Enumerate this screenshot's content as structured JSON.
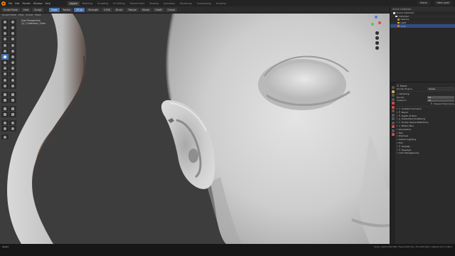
{
  "app": {
    "menu": [
      "File",
      "Edit",
      "Render",
      "Window",
      "Help"
    ],
    "workspaces": [
      "Layout",
      "Modeling",
      "Sculpting",
      "UV Editing",
      "Texture Paint",
      "Shading",
      "Animation",
      "Rendering",
      "Compositing",
      "Scripting"
    ],
    "active_workspace": "Layout",
    "scene": "Scene",
    "view_layer": "View Layer"
  },
  "header": {
    "mode": "Sculpt Mode",
    "items": [
      "View",
      "Sculpt",
      "Mask",
      "Face Sets"
    ],
    "brush_chips": [
      "Draw",
      "Radius",
      "25 px",
      "Strength",
      "0.500"
    ],
    "right_chips": [
      "Brush",
      "Texture",
      "Stroke",
      "Falloff",
      "Cursor"
    ]
  },
  "viewport": {
    "overlay_text": [
      "User Perspective",
      "(1) | Collection | Scan"
    ],
    "subheader": [
      "Sculpt Mode",
      "View",
      "Sculpt",
      "Mask"
    ]
  },
  "outliner": {
    "title": "Scene Collection",
    "rows": [
      {
        "label": "Scene Collection",
        "icon": "collection-icon",
        "state": "normal"
      },
      {
        "label": "Collection",
        "icon": "collection-icon",
        "state": "alt"
      },
      {
        "label": "Camera",
        "icon": "camera-icon",
        "state": "normal"
      },
      {
        "label": "Light",
        "icon": "light-icon",
        "state": "alt"
      },
      {
        "label": "Scan",
        "icon": "object-icon",
        "state": "selected"
      }
    ]
  },
  "properties": {
    "object": "Scene",
    "render_engine_label": "Render Engine",
    "render_engine": "Eevee",
    "sampling_label": "Sampling",
    "render_label": "Render",
    "render_value": "64",
    "viewport_label": "Viewport",
    "viewport_value": "16",
    "denoising_label": "Viewport Denoising",
    "sections": [
      "Ambient Occlusion",
      "Bloom",
      "Depth of Field",
      "Subsurface Scattering",
      "Screen Space Reflections",
      "Motion Blur",
      "Volumetrics",
      "Hair",
      "Shadows",
      "Indirect Lighting",
      "Film",
      "Simplify",
      "Freestyle",
      "Color Management"
    ]
  },
  "status": {
    "left": "Select",
    "right": "Scan | Verts:246,768 | Faces:246,722 | Tris:493,444 | Objects:1/3 | 2.90.0"
  },
  "colors": {
    "accent_blue": "#4772b3",
    "brand_orange": "#e87d0d",
    "viewport_bg": "#3d3d3d",
    "sculpt_clay": "#cfcfcf"
  }
}
